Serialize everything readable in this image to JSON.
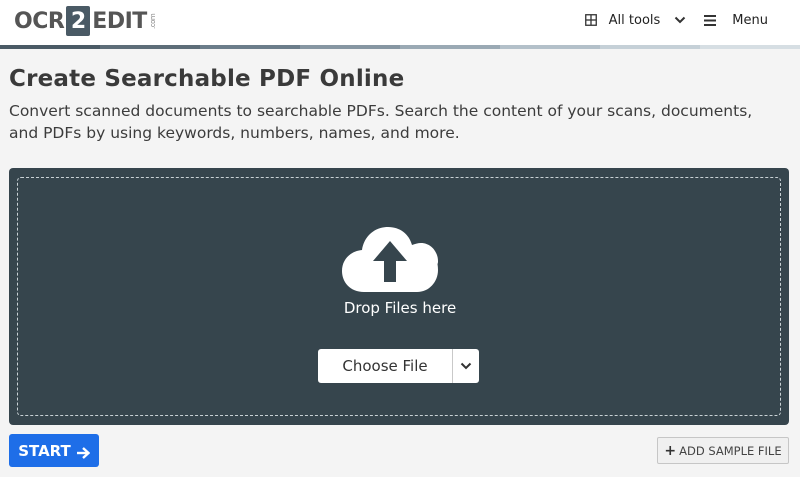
{
  "header": {
    "logo": {
      "part1": "OCR",
      "part2": "2",
      "part3": "EDIT",
      "suffix": ".com"
    },
    "nav": {
      "all_tools_label": "All tools",
      "menu_label": "Menu"
    },
    "stripe_colors": [
      "#4a5a65",
      "#5d6d78",
      "#6b7d8a",
      "#8696a2",
      "#9aa9b4",
      "#b3c0c9",
      "#c5d0d7",
      "#d6dee3"
    ]
  },
  "main": {
    "title": "Create Searchable PDF Online",
    "description": "Convert scanned documents to searchable PDFs. Search the content of your scans, documents, and PDFs by using keywords, numbers, names, and more."
  },
  "dropzone": {
    "icon": "cloud-upload-icon",
    "drop_text": "Drop Files here",
    "choose_label": "Choose File"
  },
  "actions": {
    "start_label": "START",
    "sample_label": "ADD SAMPLE FILE"
  },
  "colors": {
    "dropzone_bg": "#36454d",
    "start_button": "#1e6ee8"
  }
}
